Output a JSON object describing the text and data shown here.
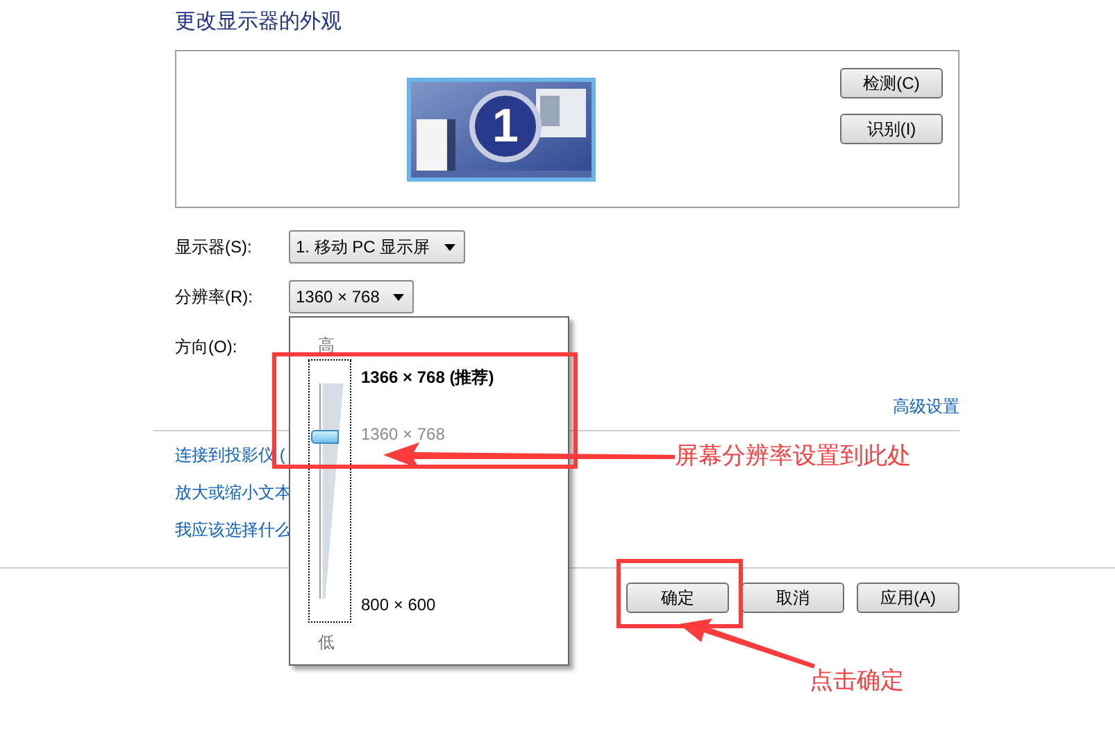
{
  "heading": "更改显示器的外观",
  "monitor_number": "1",
  "preview_buttons": [
    "检测(C)",
    "识别(I)"
  ],
  "fields": [
    {
      "label": "显示器(S):",
      "value": "1. 移动 PC 显示屏"
    },
    {
      "label": "分辨率(R):",
      "value": "1360 × 768"
    },
    {
      "label": "方向(O):"
    }
  ],
  "advanced_link": "高级设置",
  "links": [
    "连接到投影仪 (",
    "放大或缩小文本",
    "我应该选择什么"
  ],
  "buttons": [
    "确定",
    "取消",
    "应用(A)"
  ],
  "resolution_popup": {
    "high": "高",
    "low": "低",
    "level": 0.75,
    "options": [
      {
        "label": "1366 × 768 (推荐)",
        "kind": "recommended",
        "selected": false
      },
      {
        "label": "1360 × 768",
        "kind": "normal",
        "selected": true
      },
      {
        "label": "800 × 600",
        "kind": "normal",
        "selected": false
      }
    ]
  },
  "annotations": [
    {
      "text": "屏幕分辨率设置到此处"
    },
    {
      "text": "点击确定"
    }
  ]
}
